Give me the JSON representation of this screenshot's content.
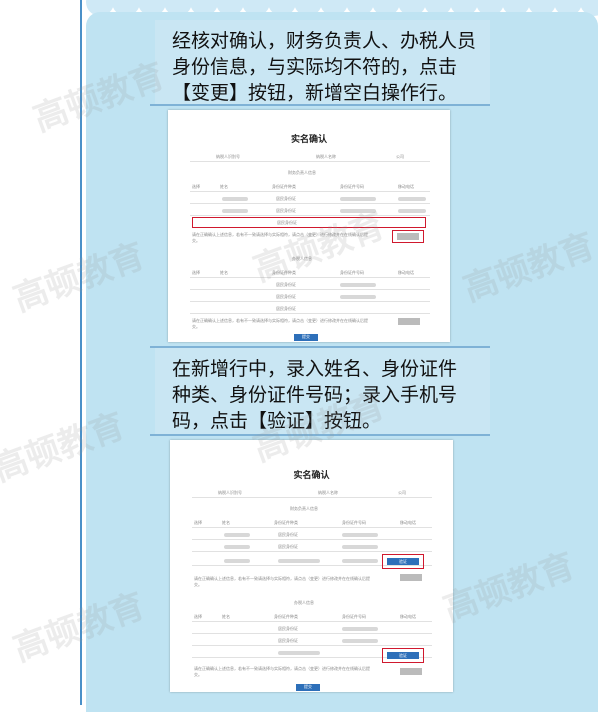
{
  "steps": [
    {
      "text": "经核对确认，财务负责人、办税人员身份信息，与实际均不符的，点击【变更】按钮，新增空白操作行。"
    },
    {
      "text": "在新增行中，录入姓名、身份证件种类、身份证件号码；录入手机号码，点击【验证】按钮。"
    }
  ],
  "form": {
    "title": "实名确认",
    "company_label": "纳税人识别号",
    "company_name_label": "纳税人名称",
    "company_suffix": "公司",
    "section_finance": "财务负责人信息",
    "section_tax": "办税人信息",
    "col_select": "选择",
    "col_name": "姓名",
    "col_id_type": "身份证件种类",
    "col_id_no": "身份证件号码",
    "col_phone": "移动电话",
    "id_type_value": "居民身份证",
    "verify_label": "验证",
    "submit_label": "提交",
    "note": "请在正确确认上述信息，若有不一致请选择与实际相符，请点击（变更）进行修改并在在线确认后提交。"
  },
  "watermark": "高顿教育",
  "colors": {
    "panel": "#bfe3f2",
    "accent": "#2d6fb9",
    "highlight": "#d0192e"
  }
}
